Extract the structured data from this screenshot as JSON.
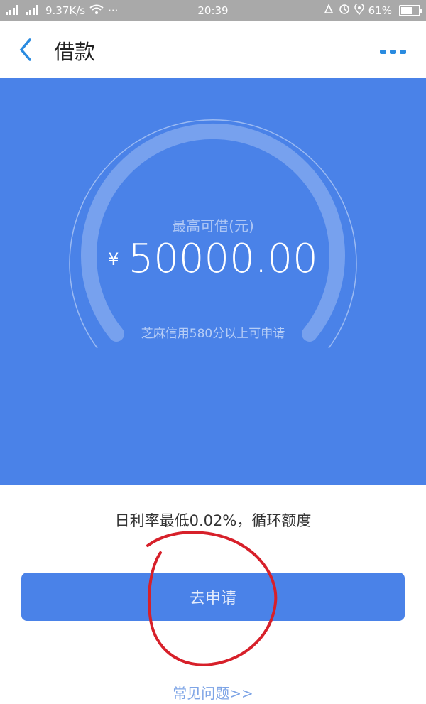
{
  "status_bar": {
    "signal1": "2G",
    "signal2": "2G",
    "speed": "9.37K/s",
    "dots": "···",
    "time": "20:39",
    "battery": "61%",
    "battery_level_pct": 61,
    "icons": [
      "signal-icon",
      "wifi-icon",
      "alarm-icon",
      "clock-icon",
      "location-icon",
      "battery-icon"
    ]
  },
  "header": {
    "title": "借款",
    "back_icon": "chevron-left-icon",
    "more_icon": "more-dots-icon"
  },
  "hero": {
    "label": "最高可借(元)",
    "currency": "¥",
    "amount": "50000.00",
    "note": "芝麻信用580分以上可申请"
  },
  "info": {
    "rate_text": "日利率最低0.02%，循环额度"
  },
  "actions": {
    "apply_label": "去申请",
    "faq_label": "常见问题>>"
  },
  "colors": {
    "primary": "#4a82e8",
    "annotation": "#d7202a"
  }
}
